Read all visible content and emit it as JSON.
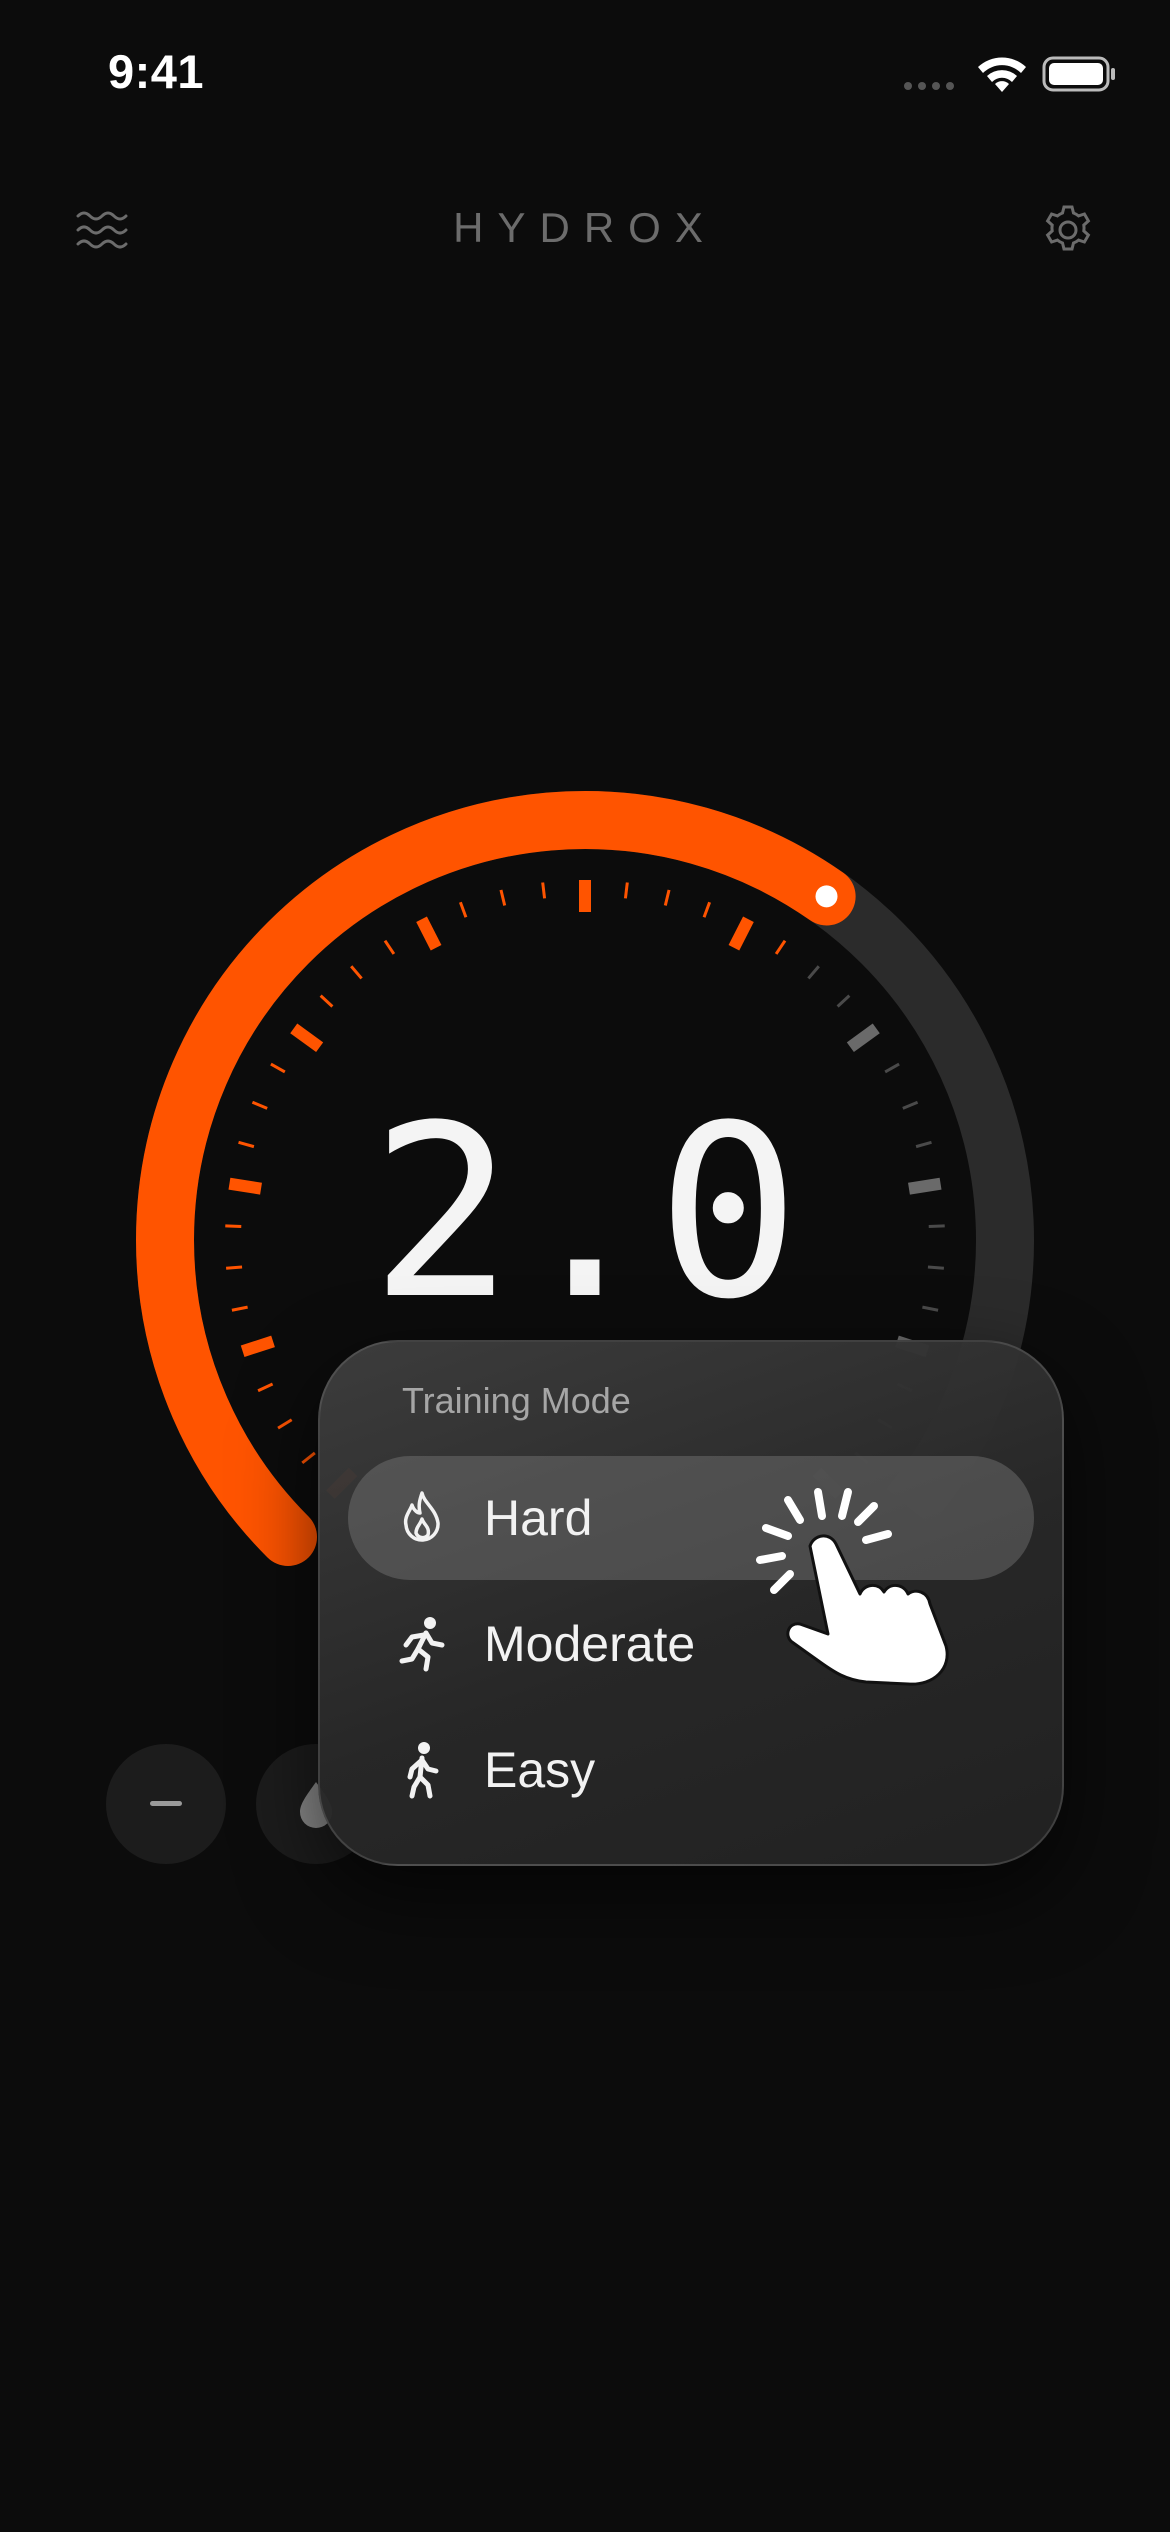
{
  "status_bar": {
    "time": "9:41"
  },
  "header": {
    "title": "HYDROX"
  },
  "gauge": {
    "value_text": "2.0",
    "level": 0.63
  },
  "popup": {
    "title": "Training Mode",
    "items": [
      {
        "label": "Hard",
        "icon": "flame-icon",
        "selected": true
      },
      {
        "label": "Moderate",
        "icon": "running-icon",
        "selected": false
      },
      {
        "label": "Easy",
        "icon": "walking-icon",
        "selected": false
      }
    ]
  },
  "colors": {
    "accent": "#ff5400",
    "track": "#2b2b2b",
    "background": "#0c0c0c"
  }
}
